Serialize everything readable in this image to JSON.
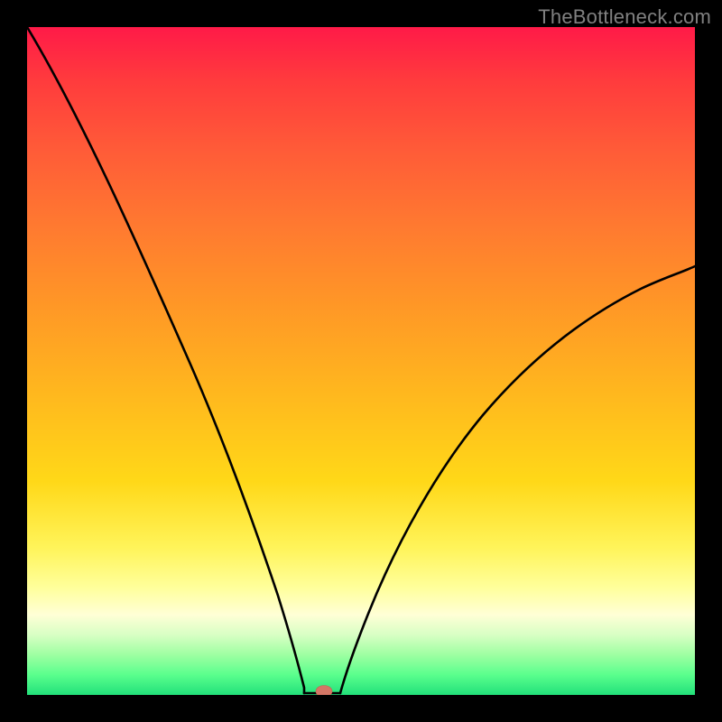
{
  "watermark": "TheBottleneck.com",
  "chart_data": {
    "type": "line",
    "title": "",
    "xlabel": "",
    "ylabel": "",
    "xlim": [
      0,
      1
    ],
    "ylim": [
      0,
      1
    ],
    "grid": false,
    "x": [
      0.0,
      0.03,
      0.06,
      0.09,
      0.12,
      0.15,
      0.18,
      0.21,
      0.24,
      0.27,
      0.3,
      0.33,
      0.36,
      0.39,
      0.41,
      0.43,
      0.45,
      0.47,
      0.5,
      0.53,
      0.56,
      0.6,
      0.65,
      0.7,
      0.75,
      0.8,
      0.85,
      0.9,
      0.95,
      1.0
    ],
    "values": [
      1.0,
      0.95,
      0.89,
      0.83,
      0.76,
      0.69,
      0.62,
      0.54,
      0.45,
      0.36,
      0.27,
      0.18,
      0.1,
      0.04,
      0.01,
      0.0,
      0.0,
      0.01,
      0.04,
      0.09,
      0.14,
      0.2,
      0.27,
      0.33,
      0.39,
      0.45,
      0.5,
      0.55,
      0.6,
      0.64
    ],
    "marker": {
      "x": 0.445,
      "y": 0.0,
      "color": "#d47766"
    },
    "background_gradient": [
      {
        "pos": 0.0,
        "color": "#ff1a48"
      },
      {
        "pos": 0.5,
        "color": "#ffa820"
      },
      {
        "pos": 0.8,
        "color": "#fff45a"
      },
      {
        "pos": 1.0,
        "color": "#22e07a"
      }
    ]
  }
}
